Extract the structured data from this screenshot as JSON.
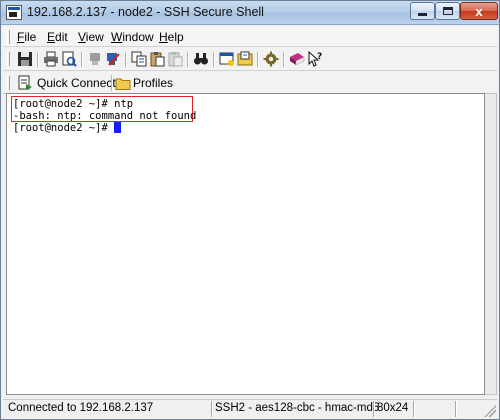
{
  "window": {
    "title": "192.168.2.137 - node2 - SSH Secure Shell",
    "close_glyph": "x"
  },
  "menu": {
    "items": [
      {
        "accel": "F",
        "rest": "ile"
      },
      {
        "accel": "E",
        "rest": "dit"
      },
      {
        "accel": "V",
        "rest": "iew"
      },
      {
        "accel": "W",
        "rest": "indow"
      },
      {
        "accel": "H",
        "rest": "elp"
      }
    ]
  },
  "toolbar": {
    "icons": [
      "save-icon",
      "print-icon",
      "print-preview-icon",
      "disconnect-icon",
      "connect-icon",
      "copy-icon",
      "paste-icon",
      "paste-disabled-icon",
      "find-icon",
      "new-terminal-icon",
      "file-transfer-icon",
      "settings-icon",
      "profiles-book-icon",
      "help-pointer-icon"
    ]
  },
  "quickbar": {
    "quick_connect_label": "Quick Connect",
    "profiles_label": "Profiles"
  },
  "terminal": {
    "lines": [
      "[root@node2 ~]# ntp",
      "-bash: ntp: command not found",
      "[root@node2 ~]# "
    ],
    "highlight_color": "#e0252b",
    "cursor_color": "#1a1aff"
  },
  "status": {
    "connection": "Connected to 192.168.2.137",
    "cipher": "SSH2 - aes128-cbc - hmac-md5",
    "size": "80x24"
  }
}
